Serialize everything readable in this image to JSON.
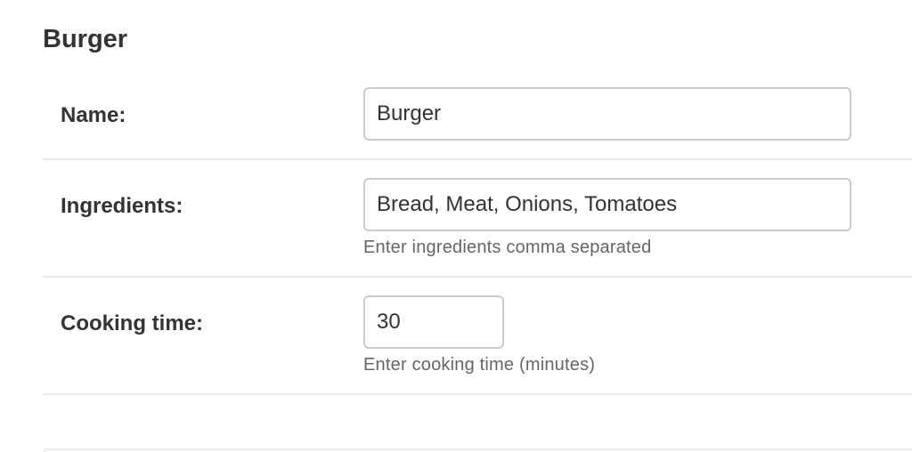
{
  "form": {
    "title": "Burger",
    "fields": [
      {
        "label": "Name:",
        "value": "Burger",
        "help": ""
      },
      {
        "label": "Ingredients:",
        "value": "Bread, Meat, Onions, Tomatoes",
        "help": "Enter ingredients comma separated"
      },
      {
        "label": "Cooking time:",
        "value": "30",
        "help": "Enter cooking time (minutes)"
      }
    ]
  }
}
